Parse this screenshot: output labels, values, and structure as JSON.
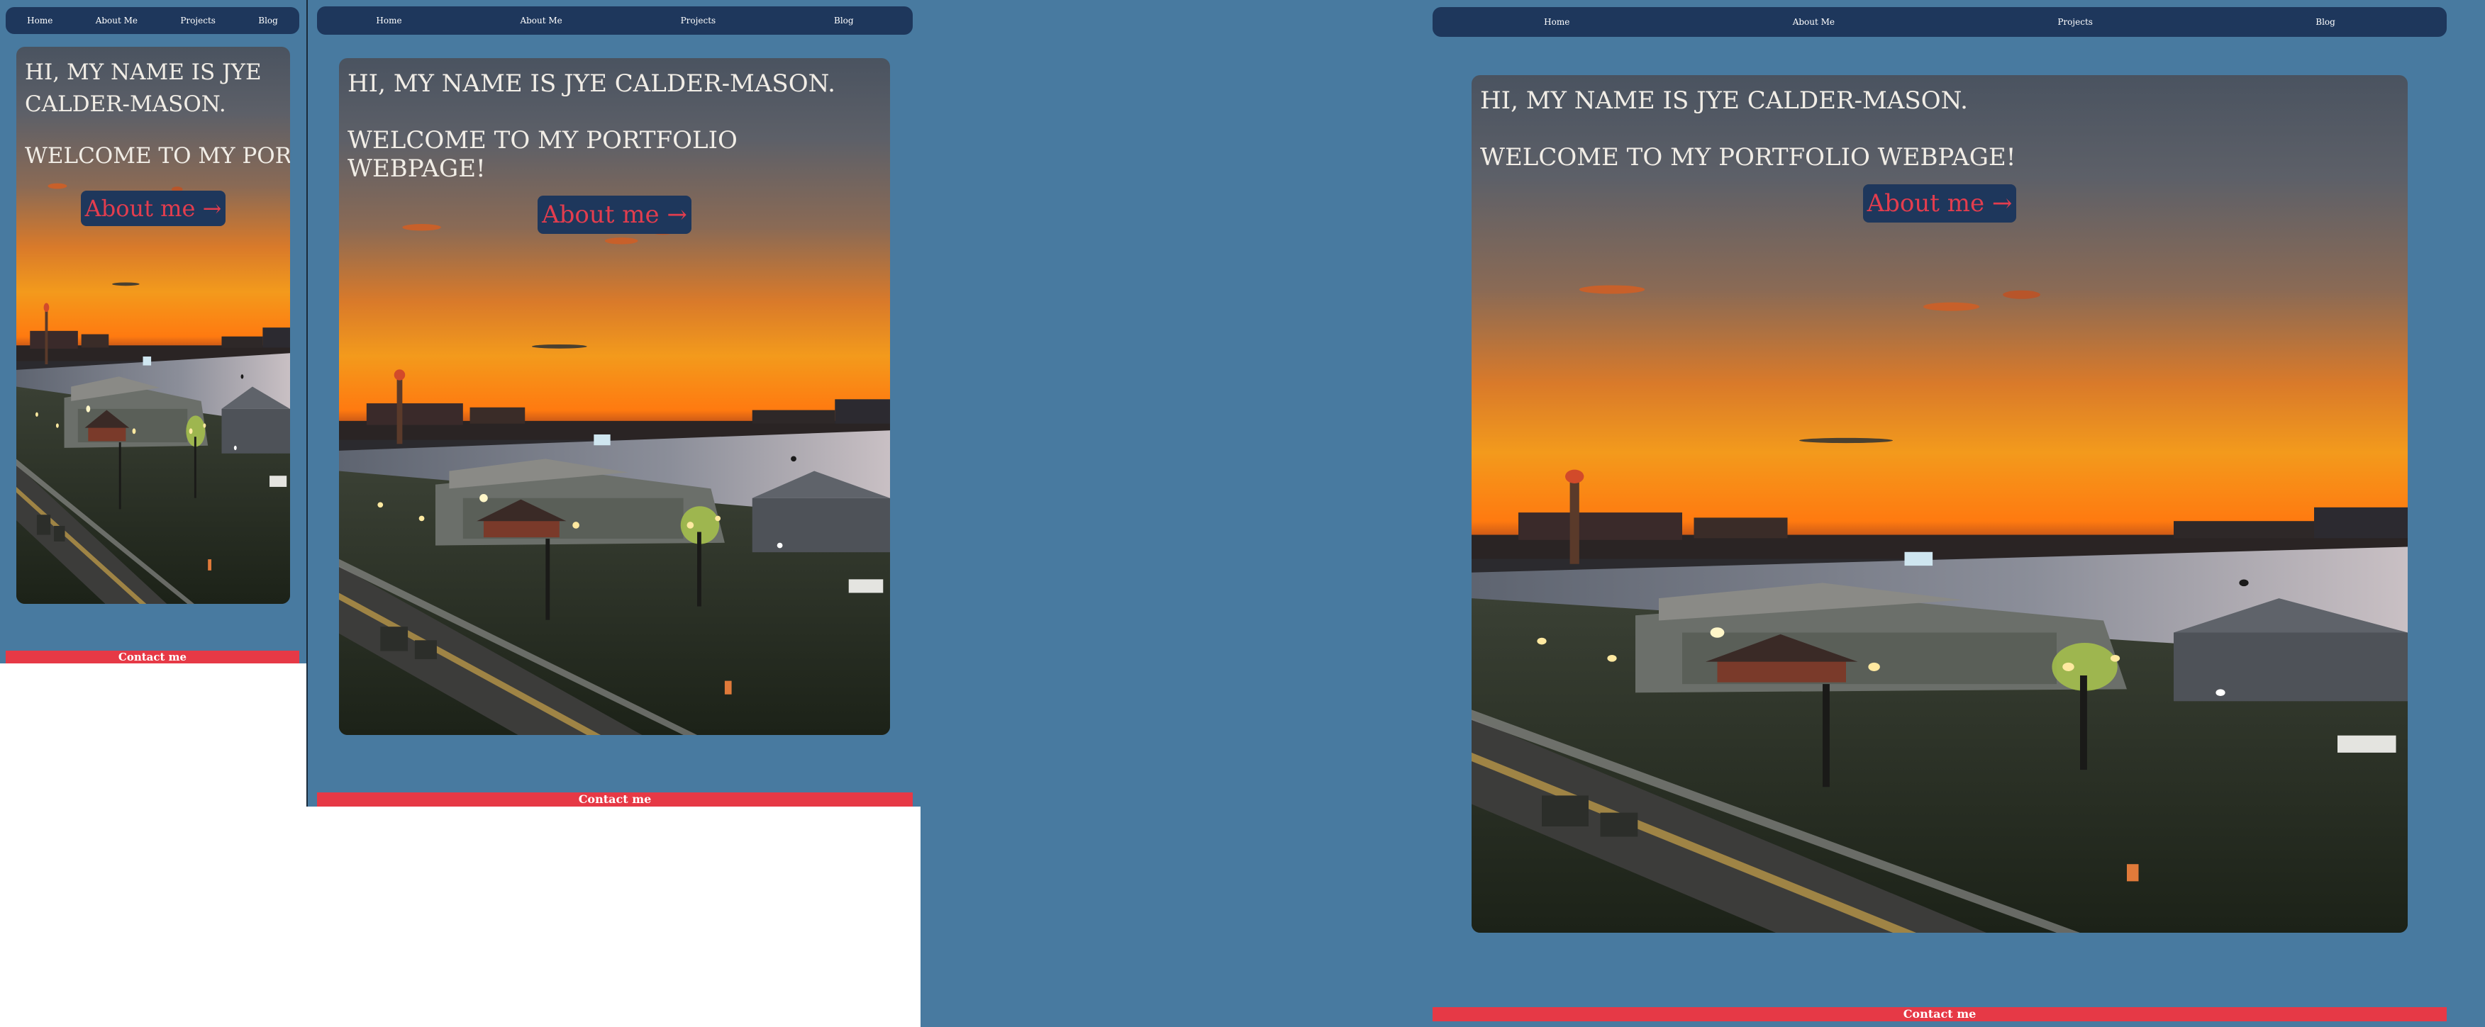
{
  "nav": {
    "home": "Home",
    "about": "About Me",
    "projects": "Projects",
    "blog": "Blog"
  },
  "hero": {
    "greeting": "HI, MY NAME IS JYE CALDER-MASON.",
    "welcome": "WELCOME TO MY PORTFOLIO WEBPAGE!",
    "cta": "About me →"
  },
  "footer": {
    "contact": "Contact me"
  },
  "colors": {
    "page_bg": "#487aa0",
    "nav_bg": "#1e375c",
    "accent_red": "#e63946",
    "cta_text": "#e33d4e"
  }
}
